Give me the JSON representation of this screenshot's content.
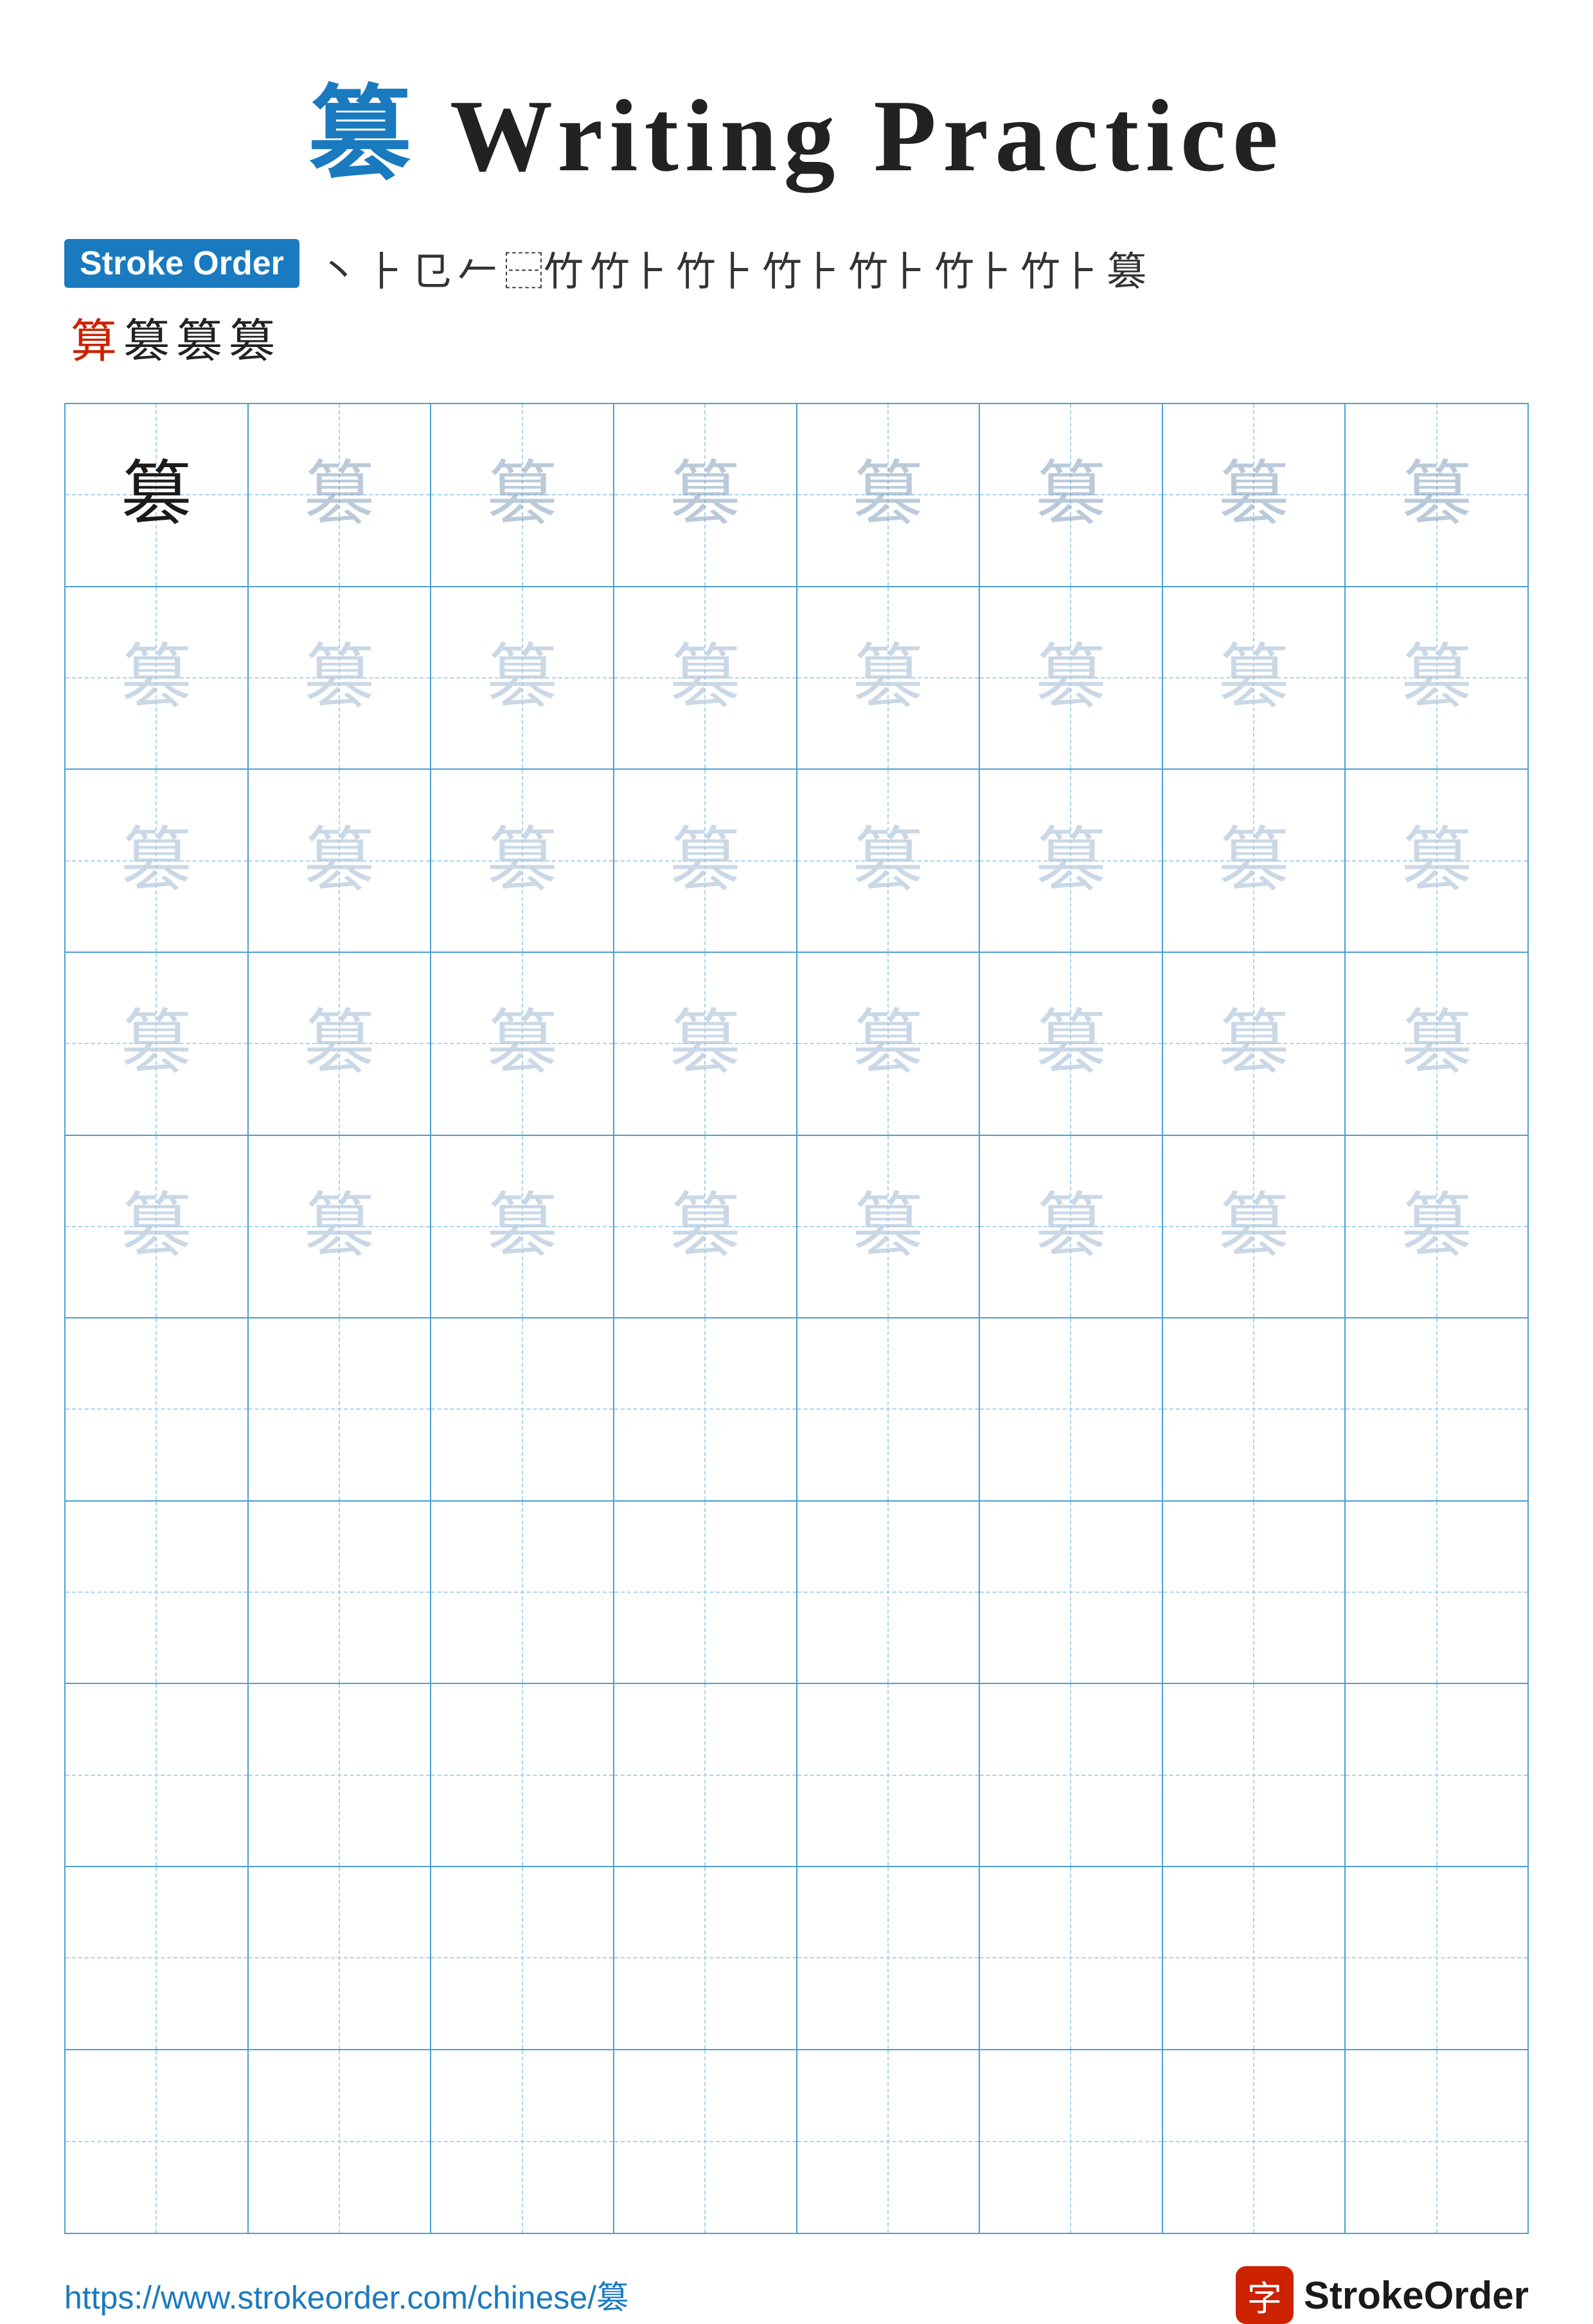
{
  "title": {
    "char": "篡",
    "text": " Writing Practice"
  },
  "stroke_order": {
    "badge_label": "Stroke Order",
    "strokes_row1": [
      "丶",
      "⺊",
      "㔾",
      "㔿",
      "竹⺊",
      "竹㔾",
      "竹㔿",
      "竹⺊",
      "竹⺊",
      "竹⺊",
      "竹⺊",
      "篡"
    ],
    "strokes_row2_chars": [
      "算",
      "篡",
      "篡",
      "篡"
    ],
    "strokes_row2_colors": [
      "red",
      "black",
      "black",
      "black"
    ]
  },
  "practice_char": "篡",
  "grid": {
    "rows": 10,
    "cols": 8
  },
  "footer": {
    "url": "https://www.strokeorder.com/chinese/篡",
    "logo_text": "StrokeOrder",
    "logo_icon": "字"
  }
}
